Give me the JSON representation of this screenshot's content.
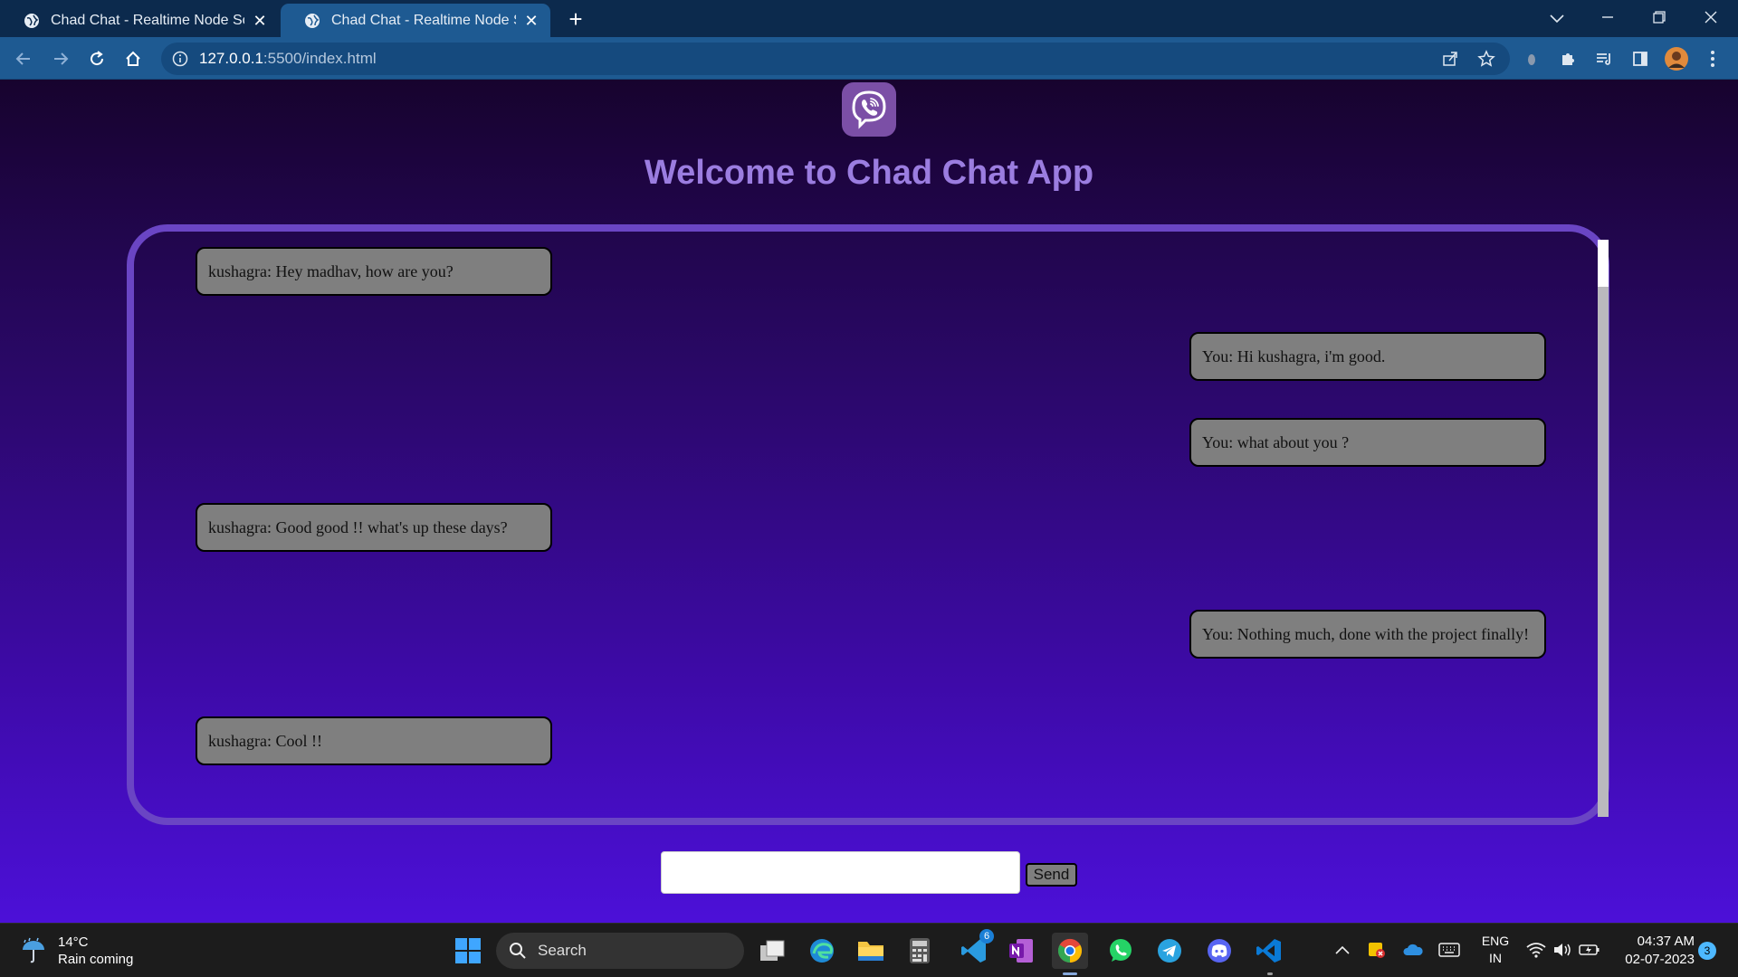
{
  "browser": {
    "tabs": [
      {
        "title": "Chad Chat - Realtime Node Sock",
        "active": false
      },
      {
        "title": "Chad Chat - Realtime Node Sock",
        "active": true
      }
    ],
    "new_tab_label": "+",
    "url_host": "127.0.0.1",
    "url_rest": ":5500/index.html"
  },
  "app": {
    "heading": "Welcome to Chad Chat App",
    "messages": [
      {
        "side": "left",
        "text": "kushagra: Hey madhav, how are you?"
      },
      {
        "side": "right",
        "text": "You: Hi kushagra, i'm good."
      },
      {
        "side": "right",
        "text": "You: what about you ?"
      },
      {
        "side": "left",
        "text": "kushagra: Good good !! what's up these days?"
      },
      {
        "side": "right",
        "text": "You: Nothing much, done with the project finally!"
      },
      {
        "side": "left",
        "text": "kushagra: Cool !!"
      }
    ],
    "input_value": "",
    "send_label": "Send"
  },
  "taskbar": {
    "weather_temp": "14°C",
    "weather_desc": "Rain coming",
    "search_label": "Search",
    "vscode_badge_count": "6",
    "lang_line1": "ENG",
    "lang_line2": "IN",
    "time": "04:37 AM",
    "date": "02-07-2023",
    "notification_count": "3"
  },
  "colors": {
    "accent": "#6a45c4",
    "heading": "#9b7de0",
    "bubble": "#7f7f7f",
    "logo_bg": "#7b4fa6"
  }
}
